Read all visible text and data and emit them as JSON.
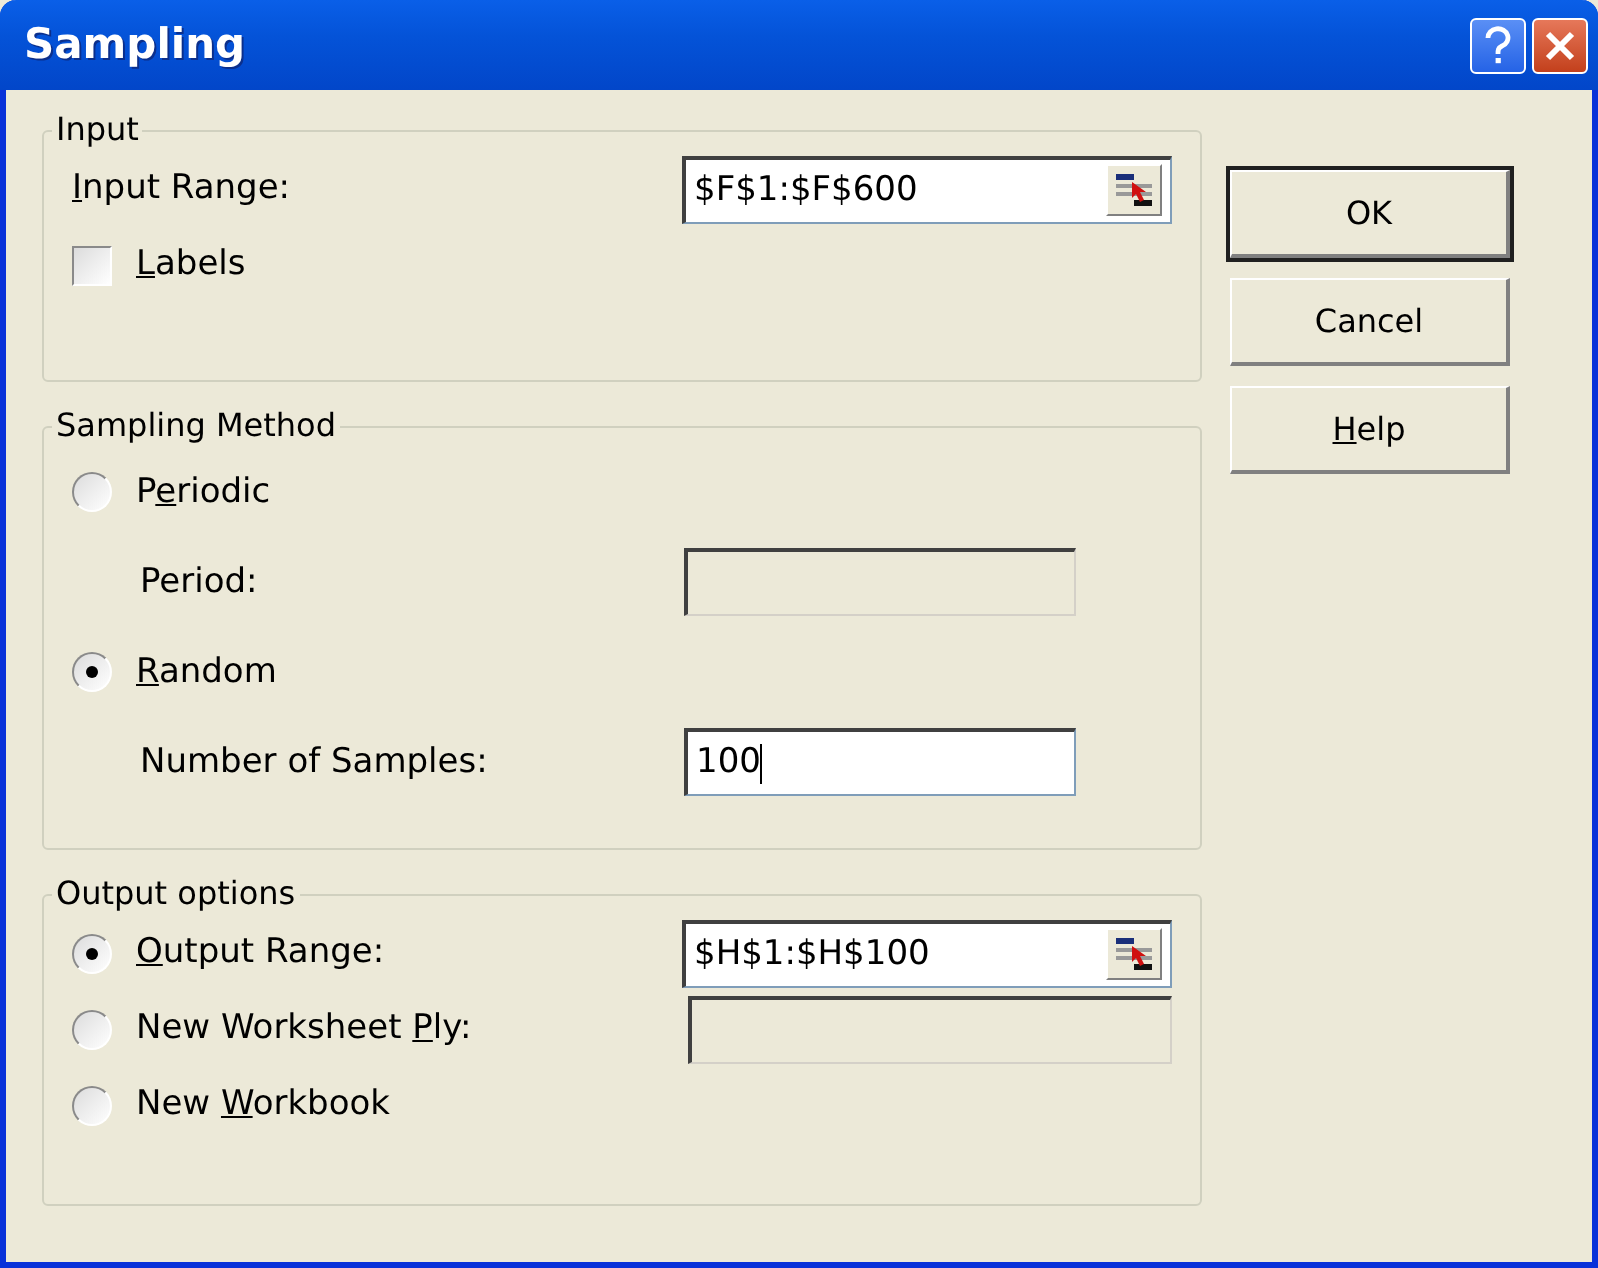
{
  "window": {
    "title": "Sampling"
  },
  "title_buttons": [
    {
      "kind": "help"
    },
    {
      "kind": "close"
    }
  ],
  "groups": [
    {
      "legend": "Input",
      "rows": [
        {
          "kind": "field",
          "indented": false,
          "label": {
            "access_key": "I",
            "after": "nput Range:"
          },
          "field": {
            "value": "$F$1:$F$600",
            "disabled": false,
            "focused": false,
            "ref_button": true
          }
        },
        {
          "kind": "checkbox",
          "checked": false,
          "label": {
            "access_key": "L",
            "after": "abels"
          }
        }
      ]
    },
    {
      "legend": "Sampling Method",
      "rows": [
        {
          "kind": "radio",
          "selected": false,
          "label": {
            "before": "P",
            "access_key": "e",
            "after": "riodic"
          }
        },
        {
          "kind": "field",
          "indented": true,
          "label": {
            "before": "Period:"
          },
          "field": {
            "disabled": true,
            "focused": false,
            "ref_button": false
          }
        },
        {
          "kind": "radio",
          "selected": true,
          "label": {
            "access_key": "R",
            "after": "andom"
          }
        },
        {
          "kind": "field",
          "indented": true,
          "label": {
            "before": "Number of Samples:"
          },
          "field": {
            "value": "100",
            "disabled": false,
            "focused": true,
            "ref_button": false
          }
        }
      ]
    },
    {
      "legend": "Output options",
      "rows": [
        {
          "kind": "radio",
          "selected": true,
          "label": {
            "access_key": "O",
            "after": "utput Range:"
          },
          "field": {
            "value": "$H$1:$H$100",
            "disabled": false,
            "focused": false,
            "ref_button": true
          }
        },
        {
          "kind": "radio",
          "selected": false,
          "label": {
            "before": "New Worksheet ",
            "access_key": "P",
            "after": "ly:"
          },
          "field": {
            "disabled": true,
            "focused": false,
            "ref_button": false
          }
        },
        {
          "kind": "radio",
          "selected": false,
          "label": {
            "before": "New ",
            "access_key": "W",
            "after": "orkbook"
          }
        }
      ]
    }
  ],
  "buttons": [
    {
      "label": {
        "before": "OK"
      },
      "default": true
    },
    {
      "label": {
        "before": "Cancel"
      },
      "default": false
    },
    {
      "label": {
        "access_key": "H",
        "after": "elp"
      },
      "default": false
    }
  ]
}
